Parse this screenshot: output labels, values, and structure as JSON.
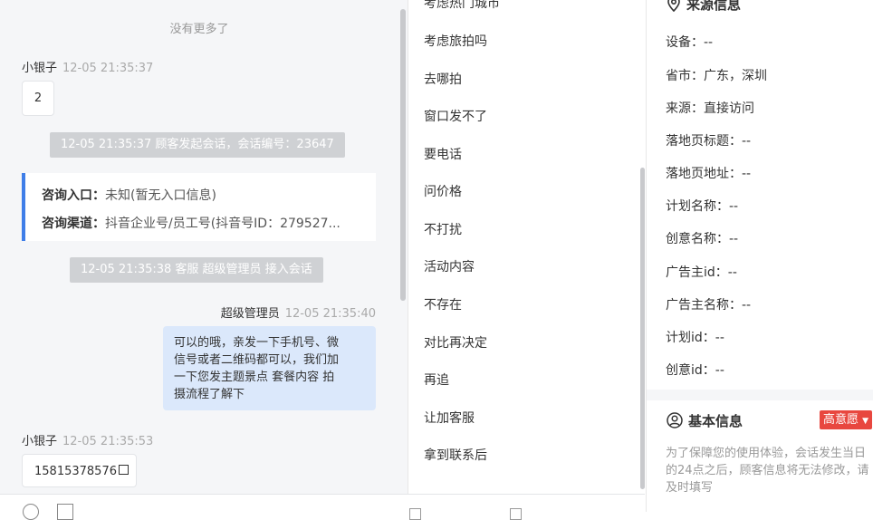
{
  "chat": {
    "no_more": "没有更多了",
    "messages": [
      {
        "sender": "小银子",
        "time": "12-05 21:35:37",
        "content": "2"
      },
      {
        "system": "12-05 21:35:37 顾客发起会话，会话编号：23647"
      },
      {
        "card": {
          "entry_label": "咨询入口：",
          "entry_value": "未知(暂无入口信息)",
          "channel_label": "咨询渠道：",
          "channel_value": "抖音企业号/员工号(抖音号ID：279527..."
        }
      },
      {
        "system": "12-05 21:35:38 客服 超级管理员 接入会话"
      },
      {
        "sender": "超级管理员",
        "time": "12-05 21:35:40",
        "content_lines": [
          "可以的哦，亲发一下手机号、微",
          "信号或者二维码都可以，我们加",
          "一下您发主题景点 套餐内容 拍",
          "摄流程了解下"
        ]
      },
      {
        "sender": "小银子",
        "time": "12-05 21:35:53",
        "content": "15815378576"
      }
    ]
  },
  "quick_replies": [
    "考虑热门城市",
    "考虑旅拍吗",
    "去哪拍",
    "窗口发不了",
    "要电话",
    "问价格",
    "不打扰",
    "活动内容",
    "不存在",
    "对比再决定",
    "再追",
    "让加客服",
    "拿到联系后"
  ],
  "info_panel": {
    "source_title": "来源信息",
    "source_fields": [
      "设备：--",
      "省市：广东，深圳",
      "来源：直接访问",
      "落地页标题：--",
      "落地页地址：--",
      "计划名称：--",
      "创意名称：--",
      "广告主id：--",
      "广告主名称：--",
      "计划id：--",
      "创意id：--"
    ],
    "basic_title": "基本信息",
    "intent_badge": "高意愿",
    "notice": "为了保障您的使用体验，会话发生当日的24点之后，顾客信息将无法修改，请及时填写"
  },
  "colors": {
    "accent": "#3f7ee8",
    "agent_bubble": "#dbe8fb",
    "intent": "#e8473f",
    "system_msg": "#cfd1d4"
  }
}
